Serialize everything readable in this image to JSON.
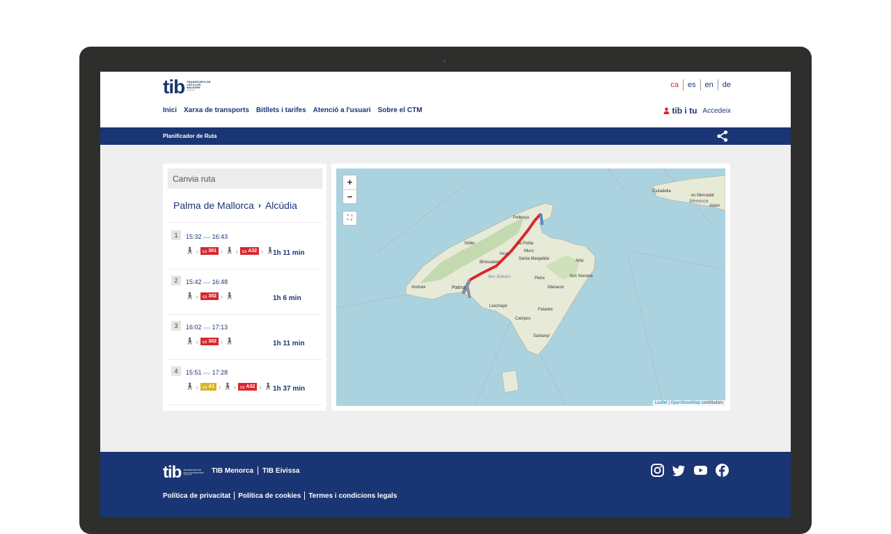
{
  "header": {
    "logo_text": "tib",
    "logo_subtitle": "TRANSPORTS DE LES ILLES BALEARS",
    "languages": [
      "ca",
      "es",
      "en",
      "de"
    ],
    "selected_language": "ca",
    "nav": [
      "Inici",
      "Xarxa de transports",
      "Bitllets i tarifes",
      "Atenció a l'usuari",
      "Sobre el CTM"
    ],
    "tib_i_tu": "tib i tu",
    "login": "Accedeix"
  },
  "bar": {
    "title": "Planificador de Ruta",
    "share_icon": "share-icon"
  },
  "planner": {
    "change_route": "Canvia ruta",
    "origin": "Palma de Mallorca",
    "destination": "Alcúdia",
    "trips": [
      {
        "num": "1",
        "depart": "15:32",
        "arrive": "16:43",
        "legs": [
          "walk",
          "301",
          "walk",
          "A32",
          "walk"
        ],
        "duration": "1h 11 min"
      },
      {
        "num": "2",
        "depart": "15:42",
        "arrive": "16:48",
        "legs": [
          "walk",
          "302",
          "walk"
        ],
        "duration": "1h 6 min"
      },
      {
        "num": "3",
        "depart": "16:02",
        "arrive": "17:13",
        "legs": [
          "walk",
          "302",
          "walk"
        ],
        "duration": "1h 11 min"
      },
      {
        "num": "4",
        "depart": "15:51",
        "arrive": "17:28",
        "legs": [
          "walk",
          "A1",
          "walk",
          "A32",
          "walk"
        ],
        "duration": "1h 37 min"
      }
    ]
  },
  "map": {
    "zoom_in": "+",
    "zoom_out": "−",
    "labels": [
      "Ciutadella",
      "es Mercadal",
      "Menorca",
      "Alaior",
      "Pollença",
      "Sóller",
      "sa Pobla",
      "Muro",
      "Inca",
      "Santa Margalida",
      "Artà",
      "Binissalem",
      "Andratx",
      "Palma",
      "Illes Balears",
      "Petra",
      "Son Servera",
      "Manacor",
      "Llucmajor",
      "Felanitx",
      "Campos",
      "Santanyí"
    ],
    "attribution_leaflet": "Leaflet",
    "attribution_osm": "OpenStreetMap",
    "attribution_suffix": "contributors",
    "route_color": "#d8262c",
    "walk_color": "#8a8fa0"
  },
  "footer": {
    "logo_text": "tib",
    "links": [
      "TIB Menorca",
      "TIB Eivissa"
    ],
    "social": [
      "instagram-icon",
      "twitter-icon",
      "youtube-icon",
      "facebook-icon"
    ],
    "legal": [
      "Política de privacitat",
      "Política de cookies",
      "Termes i condicions legals"
    ]
  }
}
